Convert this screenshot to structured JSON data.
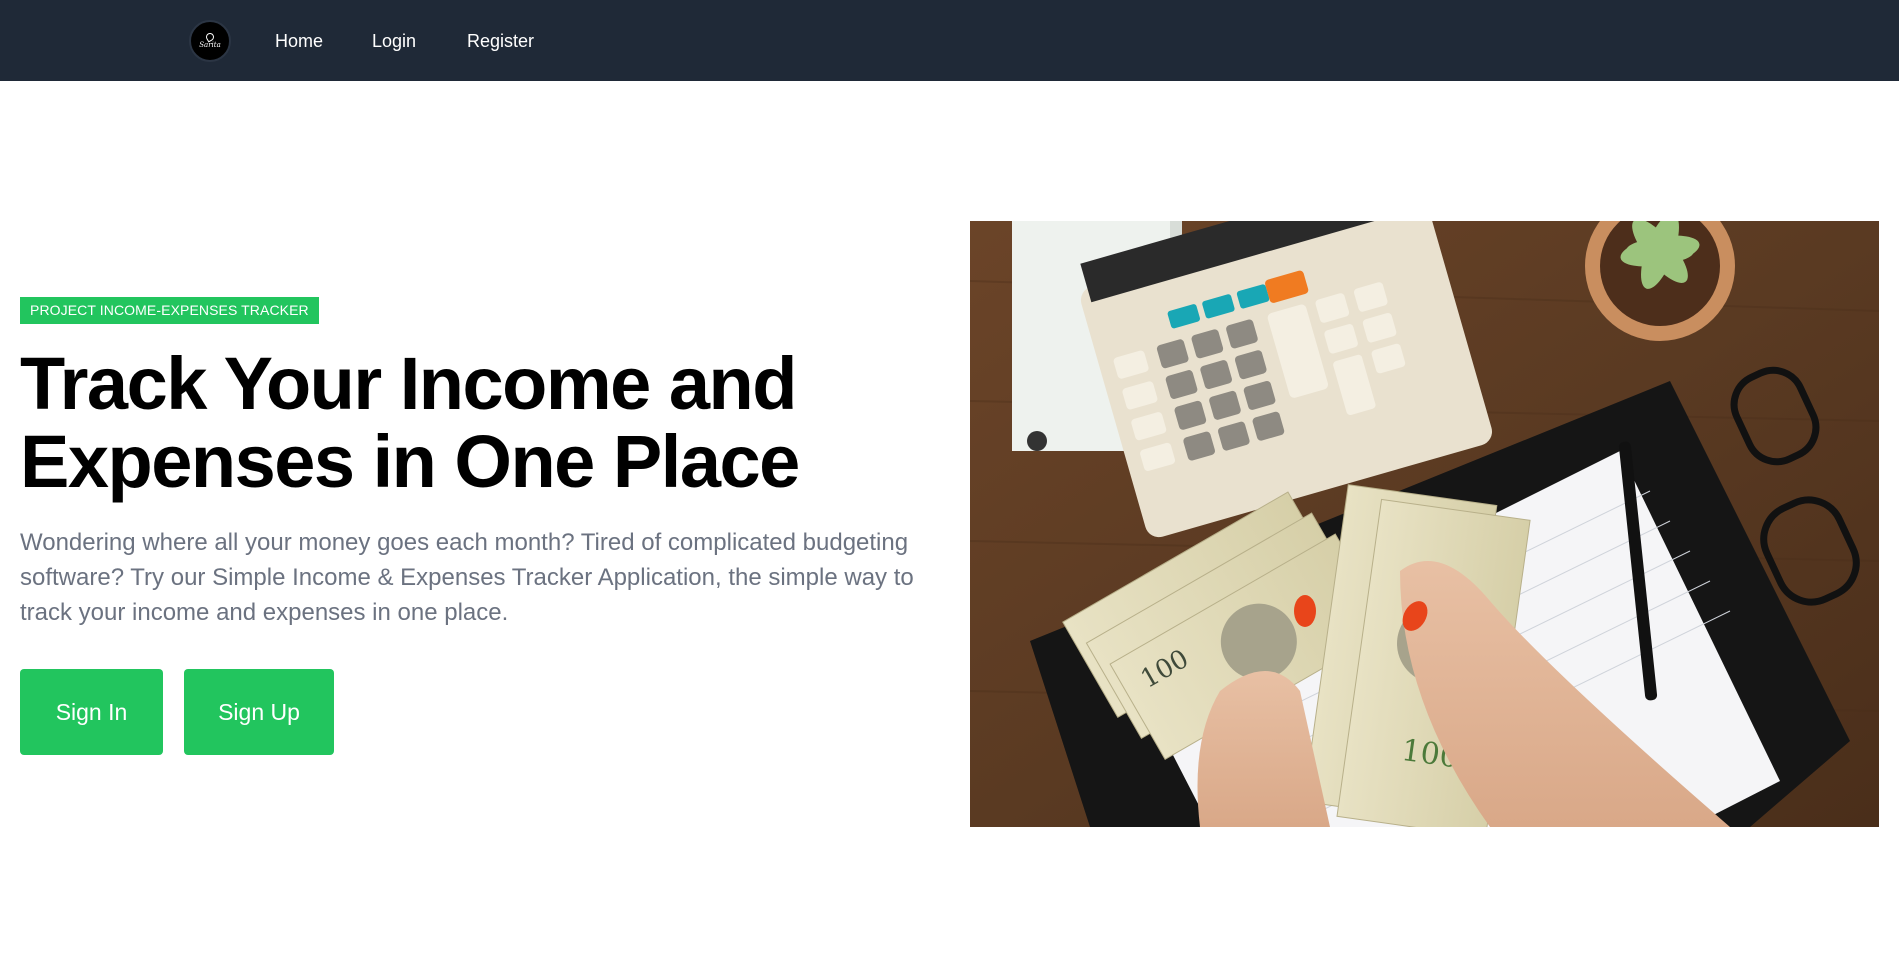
{
  "nav": {
    "logo_text": "Sarita",
    "links": [
      "Home",
      "Login",
      "Register"
    ]
  },
  "hero": {
    "badge": "PROJECT INCOME-EXPENSES TRACKER",
    "headline_line1": "Track Your Income and",
    "headline_line2": "Expenses in One Place",
    "description": "Wondering where all your money goes each month? Tired of complicated budgeting software? Try our Simple Income & Expenses Tracker Application, the simple way to track your income and expenses in one place.",
    "signin_label": "Sign In",
    "signup_label": "Sign Up"
  },
  "image": {
    "icon": "finance-photo-icon"
  },
  "colors": {
    "navbar": "#1f2937",
    "accent": "#22c55e",
    "muted_text": "#6b7280"
  }
}
